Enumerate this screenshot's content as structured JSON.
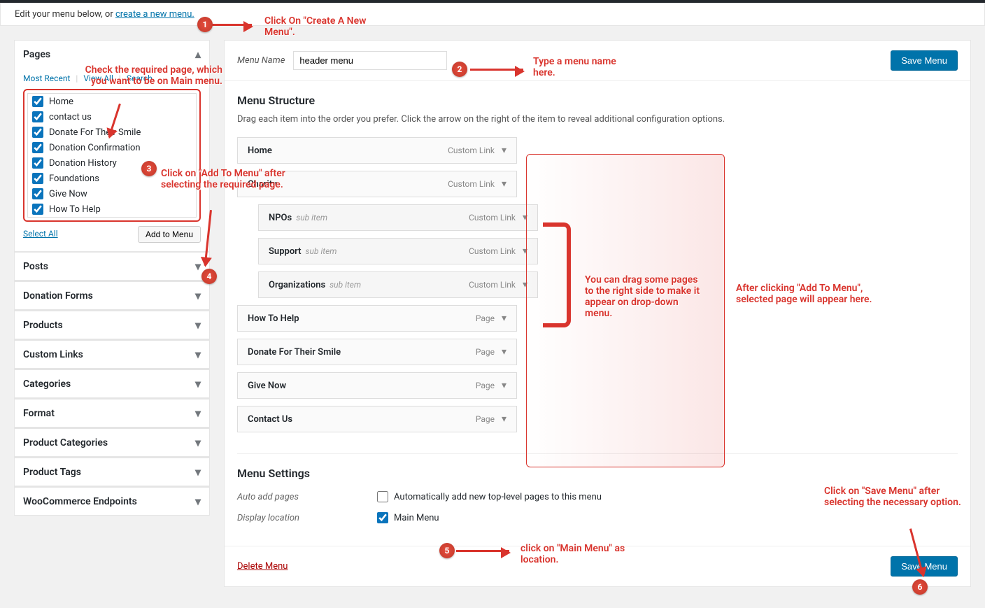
{
  "edit_notice": {
    "prefix": "Edit your menu below, or ",
    "link": "create a new menu."
  },
  "sidebar": {
    "pages_title": "Pages",
    "tabs": {
      "recent": "Most Recent",
      "viewall": "View All",
      "search": "Search"
    },
    "page_items": [
      "Home",
      "contact us",
      "Donate For Their Smile",
      "Donation Confirmation",
      "Donation History",
      "Foundations",
      "Give Now",
      "How To Help"
    ],
    "select_all": "Select All",
    "add_to_menu": "Add to Menu",
    "accordions": [
      "Posts",
      "Donation Forms",
      "Products",
      "Custom Links",
      "Categories",
      "Format",
      "Product Categories",
      "Product Tags",
      "WooCommerce Endpoints"
    ]
  },
  "menu": {
    "name_label": "Menu Name",
    "name_value": "header menu",
    "save_btn": "Save Menu",
    "structure_title": "Menu Structure",
    "structure_desc": "Drag each item into the order you prefer. Click the arrow on the right of the item to reveal additional configuration options.",
    "items": [
      {
        "title": "Home",
        "sub": false,
        "type": "Custom Link"
      },
      {
        "title": "Charity",
        "sub": false,
        "type": "Custom Link"
      },
      {
        "title": "NPOs",
        "sub": true,
        "type": "Custom Link"
      },
      {
        "title": "Support",
        "sub": true,
        "type": "Custom Link"
      },
      {
        "title": "Organizations",
        "sub": true,
        "type": "Custom Link"
      },
      {
        "title": "How To Help",
        "sub": false,
        "type": "Page"
      },
      {
        "title": "Donate For Their Smile",
        "sub": false,
        "type": "Page"
      },
      {
        "title": "Give Now",
        "sub": false,
        "type": "Page"
      },
      {
        "title": "Contact Us",
        "sub": false,
        "type": "Page"
      }
    ],
    "sub_item_label": "sub item",
    "settings_title": "Menu Settings",
    "auto_add_label": "Auto add pages",
    "auto_add_text": "Automatically add new top-level pages to this menu",
    "display_loc_label": "Display location",
    "display_loc_text": "Main Menu",
    "delete_menu": "Delete Menu"
  },
  "annotations": {
    "a1": "Click On \"Create A New Menu\".",
    "a2": "Type a menu name here.",
    "a3_top": "Check the required page, which you want to be on Main menu.",
    "a3_mid": "Click on \"Add To Menu\" after selecting the required page.",
    "a4": "You can drag some pages to the right side to make it appear on drop-down menu.",
    "a5": "After clicking \"Add To Menu\", selected page will appear here.",
    "a6": "click on \"Main Menu\" as location.",
    "a7": "Click on \"Save Menu\" after selecting the necessary option."
  }
}
